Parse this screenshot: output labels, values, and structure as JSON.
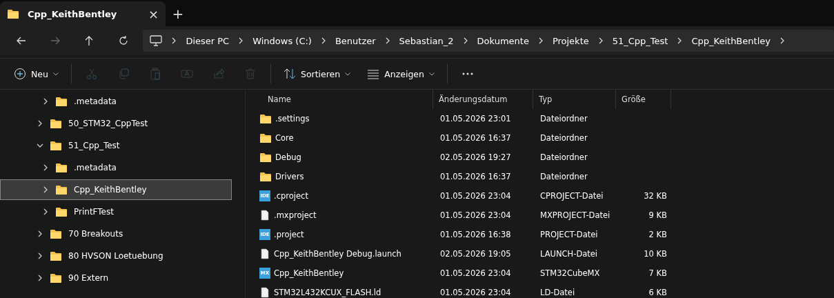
{
  "tabs": [
    {
      "title": "Cpp_KeithBentley",
      "selected": true,
      "close": "×"
    }
  ],
  "new_tab": "+",
  "nav": [
    {
      "kind": "back",
      "disabled": false
    },
    {
      "kind": "forward",
      "disabled": true
    },
    {
      "kind": "up",
      "disabled": false
    },
    {
      "kind": "refresh",
      "disabled": false
    }
  ],
  "breadcrumb": [
    "Dieser PC",
    "Windows (C:)",
    "Benutzer",
    "Sebastian_2",
    "Dokumente",
    "Projekte",
    "51_Cpp_Test",
    "Cpp_KeithBentley"
  ],
  "commands": [
    {
      "kind": "new",
      "label": "Neu",
      "disabled": false
    },
    {
      "kind": "cut",
      "disabled": true
    },
    {
      "kind": "copy",
      "disabled": true
    },
    {
      "kind": "paste",
      "disabled": true
    },
    {
      "kind": "rename",
      "disabled": true
    },
    {
      "kind": "share",
      "disabled": true
    },
    {
      "kind": "delete",
      "disabled": true
    },
    {
      "kind": "sort",
      "label": "Sortieren",
      "disabled": false
    },
    {
      "kind": "view",
      "label": "Anzeigen",
      "disabled": false
    },
    {
      "kind": "more"
    }
  ],
  "tree": [
    {
      "children": [
        {
          "label": ".metadata",
          "expanded": false,
          "selected": false
        }
      ]
    },
    {
      "label": "50_STM32_CppTest",
      "expanded": false,
      "selected": false
    },
    {
      "label": "51_Cpp_Test",
      "expanded": true,
      "selected": false,
      "children": [
        {
          "label": ".metadata",
          "expanded": false,
          "selected": false
        },
        {
          "label": "Cpp_KeithBentley",
          "expanded": false,
          "selected": true
        },
        {
          "label": "PrintFTest",
          "expanded": false,
          "selected": false
        }
      ]
    },
    {
      "label": "70 Breakouts",
      "expanded": false,
      "selected": false
    },
    {
      "label": "80 HVSON Loetuebung",
      "expanded": false,
      "selected": false
    },
    {
      "label": "90 Extern",
      "expanded": false,
      "selected": false
    }
  ],
  "table": {
    "columns": [
      "Name",
      "Änderungsdatum",
      "Typ",
      "Größe"
    ],
    "rows": [
      {
        "kind": "folder",
        "name": ".settings",
        "date": "01.05.2026 23:01",
        "type": "Dateiordner"
      },
      {
        "kind": "folder",
        "name": "Core",
        "date": "01.05.2026 16:37",
        "type": "Dateiordner"
      },
      {
        "kind": "folder",
        "name": "Debug",
        "date": "02.05.2026 19:27",
        "type": "Dateiordner"
      },
      {
        "kind": "folder",
        "name": "Drivers",
        "date": "01.05.2026 16:37",
        "type": "Dateiordner"
      },
      {
        "kind": "ide",
        "badge": "IDE",
        "name": ".cproject",
        "date": "01.05.2026 23:04",
        "type": "CPROJECT-Datei",
        "size": "32 KB"
      },
      {
        "kind": "file",
        "name": ".mxproject",
        "date": "01.05.2026 23:04",
        "type": "MXPROJECT-Datei",
        "size": "9 KB"
      },
      {
        "kind": "ide",
        "badge": "IDE",
        "name": ".project",
        "date": "01.05.2026 16:38",
        "type": "PROJECT-Datei",
        "size": "2 KB"
      },
      {
        "kind": "file",
        "name": "Cpp_KeithBentley Debug.launch",
        "date": "02.05.2026 19:05",
        "type": "LAUNCH-Datei",
        "size": "10 KB"
      },
      {
        "kind": "mx",
        "badge": "MX",
        "name": "Cpp_KeithBentley",
        "date": "01.05.2026 23:04",
        "type": "STM32CubeMX",
        "size": "7 KB"
      },
      {
        "kind": "file",
        "name": "STM32L432KCUX_FLASH.ld",
        "date": "01.05.2026 23:04",
        "type": "LD-Datei",
        "size": "6 KB"
      }
    ]
  }
}
